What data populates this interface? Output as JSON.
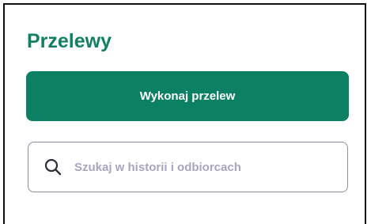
{
  "section": {
    "title": "Przelewy"
  },
  "actions": {
    "make_transfer_label": "Wykonaj przelew"
  },
  "search": {
    "placeholder": "Szukaj w historii i odbiorcach",
    "value": "",
    "icon": "search-icon"
  },
  "colors": {
    "accent": "#0b8062",
    "title": "#108063",
    "placeholder": "#a9a6bc",
    "input_border": "#8f8c9e"
  }
}
